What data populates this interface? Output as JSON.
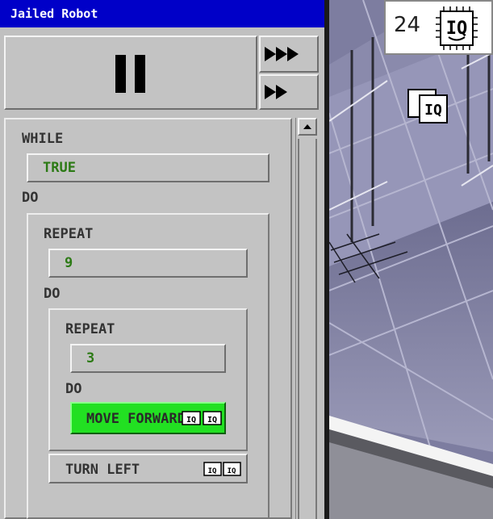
{
  "window": {
    "title": "Jailed Robot"
  },
  "controls": {
    "pause_icon": "pause-icon",
    "fast_forward_3_icon": "triple-arrow-icon",
    "fast_forward_2_icon": "double-arrow-icon"
  },
  "program": {
    "while_kw": "WHILE",
    "while_condition": "TRUE",
    "do_kw_1": "DO",
    "repeat_kw_1": "REPEAT",
    "repeat_count_1": "9",
    "do_kw_2": "DO",
    "repeat_kw_2": "REPEAT",
    "repeat_count_2": "3",
    "do_kw_3": "DO",
    "move_forward": "MOVE FORWARD",
    "turn_left": "TURN LEFT"
  },
  "hud": {
    "chip_count": "24",
    "chip_label": "IQ"
  },
  "colors": {
    "title_bar": "#0000c8",
    "active_command": "#22e022",
    "slot_text": "#2c7a15"
  }
}
